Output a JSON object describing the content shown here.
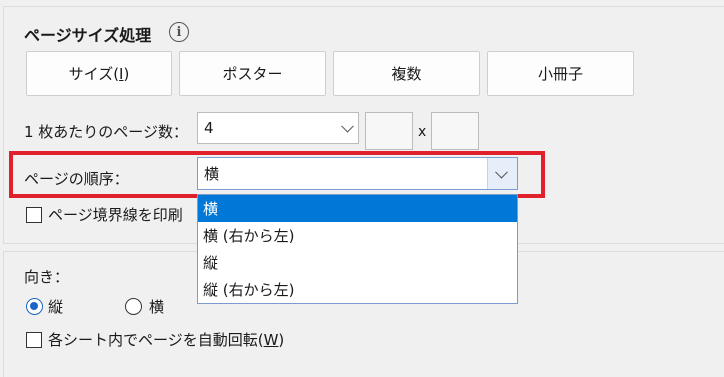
{
  "section": {
    "title": "ページサイズ処理",
    "info_icon": "info-icon"
  },
  "buttons": {
    "size_text": "サイズ(",
    "size_key": "I",
    "size_end": ")",
    "poster": "ポスター",
    "multiple": "複数",
    "booklet": "小冊子"
  },
  "pages_per_sheet": {
    "label": "1 枚あたりのページ数：",
    "value": "4",
    "separator": "x"
  },
  "page_order": {
    "label": "ページの順序：",
    "value": "横",
    "options": [
      "横",
      "横 (右から左)",
      "縦",
      "縦 (右から左)"
    ]
  },
  "print_borders": {
    "label": "ページ境界線を印刷"
  },
  "orientation": {
    "label": "向き：",
    "vertical": "縦",
    "horizontal": "横"
  },
  "auto_rotate": {
    "label_text": "各シート内でページを自動回転(",
    "key": "W",
    "end": ")"
  },
  "colors": {
    "highlight": "#e0202a",
    "accent": "#0078d7"
  }
}
